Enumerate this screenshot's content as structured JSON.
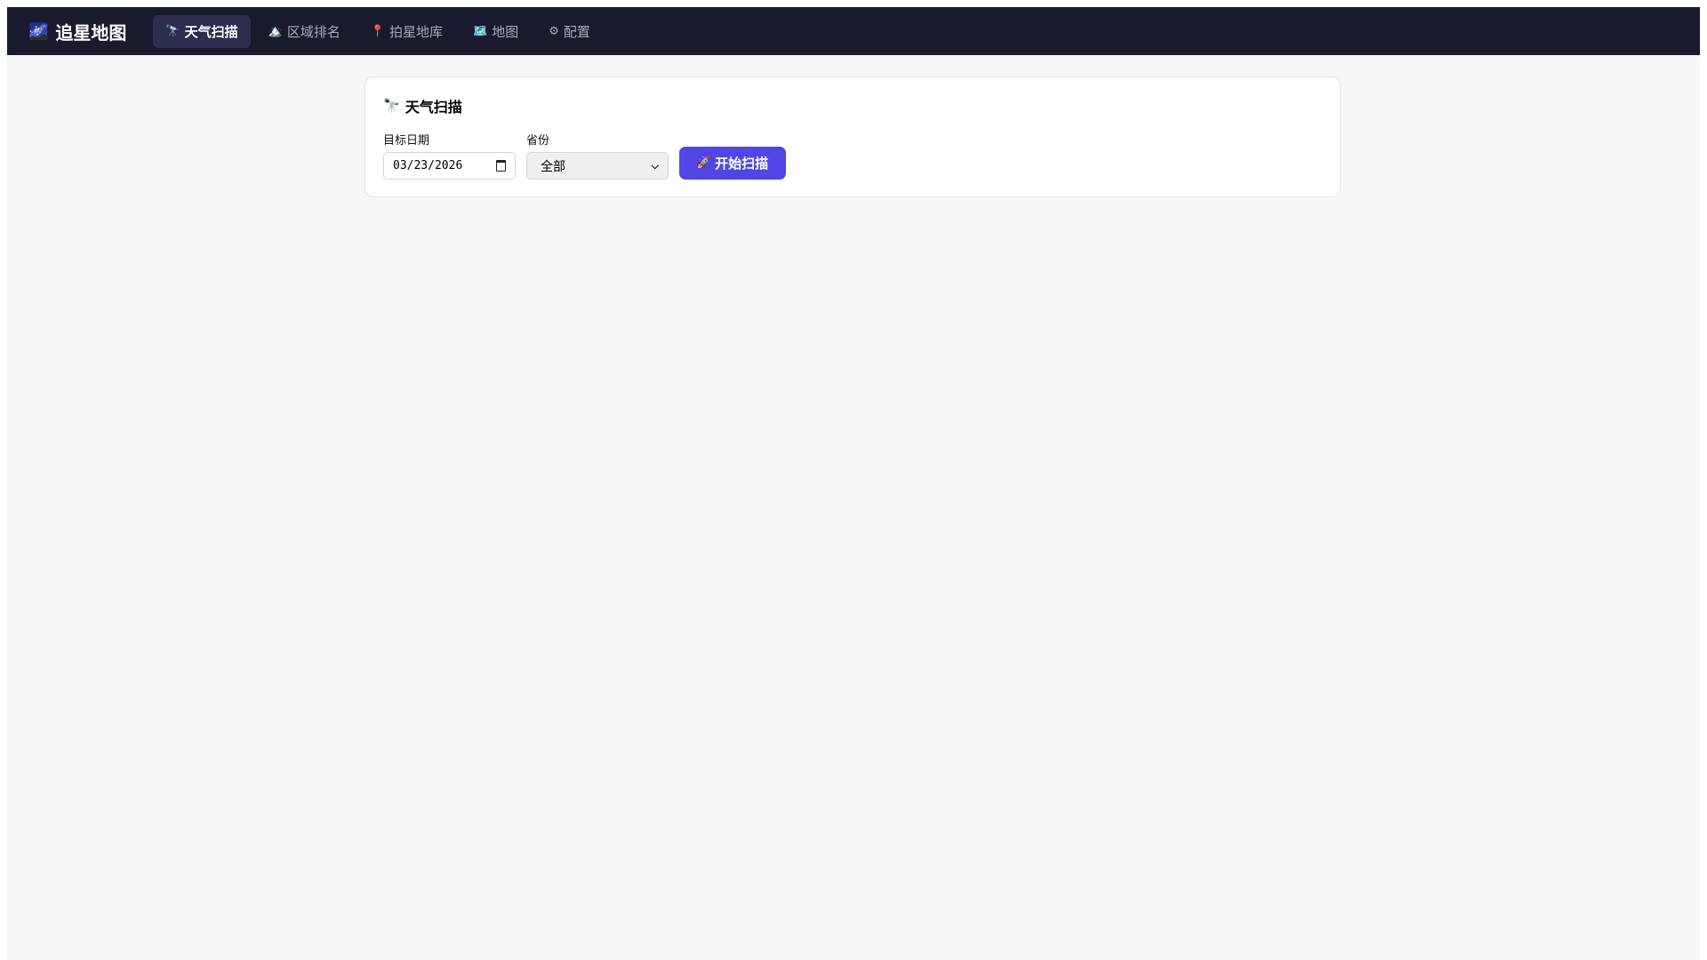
{
  "app": {
    "title": "追星地图",
    "logo_icon": "🌌"
  },
  "nav": {
    "tabs": [
      {
        "icon": "🔭",
        "label": "天气扫描",
        "active": true
      },
      {
        "icon": "🏔️",
        "label": "区域排名"
      },
      {
        "icon": "📍",
        "label": "拍星地库"
      },
      {
        "icon": "🗺️",
        "label": "地图"
      },
      {
        "icon": "⚙",
        "label": "配置"
      }
    ]
  },
  "scan": {
    "icon": "🔭",
    "title": "天气扫描",
    "date_label": "目标日期",
    "date_value": "03/23/2026",
    "province_label": "省份",
    "province_value": "全部",
    "button_icon": "🚀",
    "button_label": "开始扫描"
  },
  "colors": {
    "nav_bg": "#1a1a2e",
    "accent": "#4f46e5"
  }
}
